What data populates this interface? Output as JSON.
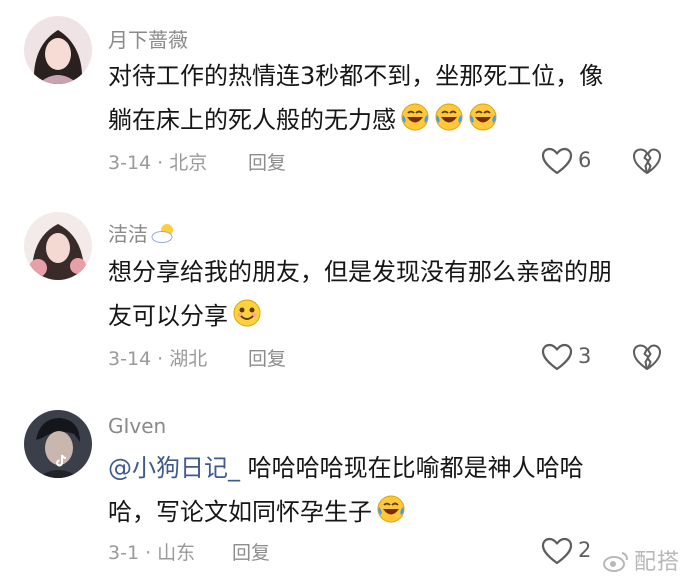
{
  "comments": [
    {
      "username": "月下蔷薇",
      "line1": "对待工作的热情连3秒都不到，坐那死工位，像",
      "line2": "躺在床上的死人般的无力感",
      "meta": "3-14 · 北京",
      "reply": "回复",
      "likes": "6"
    },
    {
      "username": "洁洁",
      "line1": "想分享给我的朋友，但是发现没有那么亲密的朋",
      "line2": "友可以分享",
      "meta": "3-14 · 湖北",
      "reply": "回复",
      "likes": "3"
    },
    {
      "username": "GIven",
      "mention": "@小狗日记_",
      "line1": "哈哈哈哈现在比喻都是神人哈哈",
      "line2": "哈，写论文如同怀孕生子",
      "meta": "3-1 · 山东",
      "reply": "回复",
      "likes": "2"
    }
  ],
  "icons": {
    "like": "heart-outline-icon",
    "dislike": "broken-heart-icon",
    "laugh": "face-with-tears-of-joy-emoji",
    "smile": "smiling-face-emoji",
    "cloud": "sun-behind-cloud-emoji",
    "platform_badge": "tiktok-icon"
  },
  "watermark": "配搭",
  "colors": {
    "username": "#8a8a8a",
    "text": "#161616",
    "meta": "#9a9a9a",
    "mention": "#3f5b8c"
  }
}
